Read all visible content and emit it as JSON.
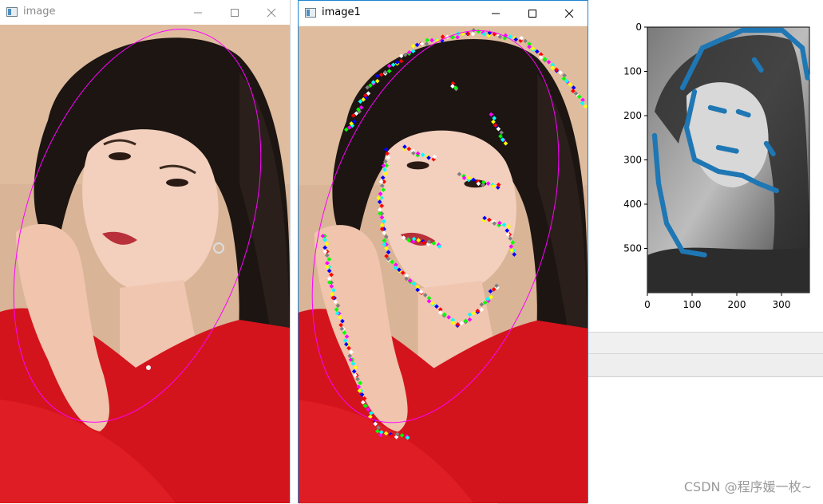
{
  "windows": [
    {
      "title": "image",
      "controls": {
        "minimize": "minimize",
        "maximize": "maximize",
        "close": "close"
      }
    },
    {
      "title": "image1",
      "controls": {
        "minimize": "minimize",
        "maximize": "maximize",
        "close": "close"
      }
    }
  ],
  "plot": {
    "x_ticks": [
      "0",
      "100",
      "200",
      "300"
    ],
    "y_ticks": [
      "0",
      "100",
      "200",
      "300",
      "400",
      "500"
    ],
    "xlim": [
      0,
      363
    ],
    "ylim": [
      600,
      0
    ],
    "point_color": "#1f77b4"
  },
  "colors": {
    "ellipse": "#ff00ff",
    "sweater": "#d4141c",
    "skin": "#f0c8b4",
    "hair": "#1c1512",
    "wall": "#dcb89c"
  },
  "watermark": "CSDN @程序媛一枚~"
}
